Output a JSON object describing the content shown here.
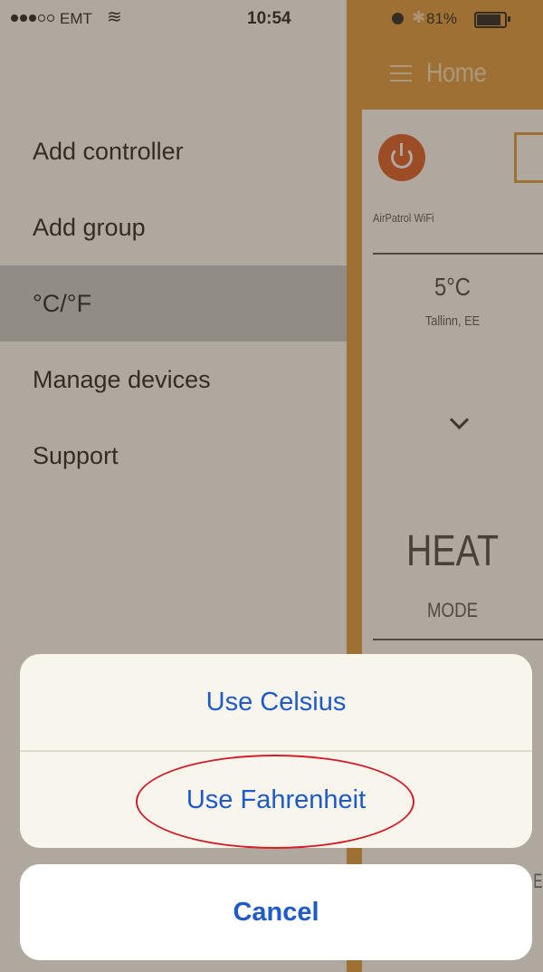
{
  "status_bar": {
    "carrier": "EMT",
    "wifi_icon": "wifi-icon",
    "time": "10:54",
    "bluetooth_icon": "bluetooth-icon",
    "battery": "81%"
  },
  "menu": {
    "items": [
      {
        "label": "Add controller",
        "active": false
      },
      {
        "label": "Add group",
        "active": false
      },
      {
        "label": "°C/°F",
        "active": true
      },
      {
        "label": "Manage devices",
        "active": false
      },
      {
        "label": "Support",
        "active": false
      }
    ]
  },
  "home": {
    "title": "Home",
    "device_name": "AirPatrol WiFi",
    "temperature": "5°C",
    "location": "Tallinn, EE",
    "mode_value": "HEAT",
    "mode_label": "MODE",
    "accent_color": "#e29a3c",
    "power_color": "#dd5a26"
  },
  "action_sheet": {
    "options": [
      "Use Celsius",
      "Use Fahrenheit"
    ],
    "cancel": "Cancel",
    "button_color": "#1e5ac8",
    "highlight_color": "#d41e2a"
  }
}
